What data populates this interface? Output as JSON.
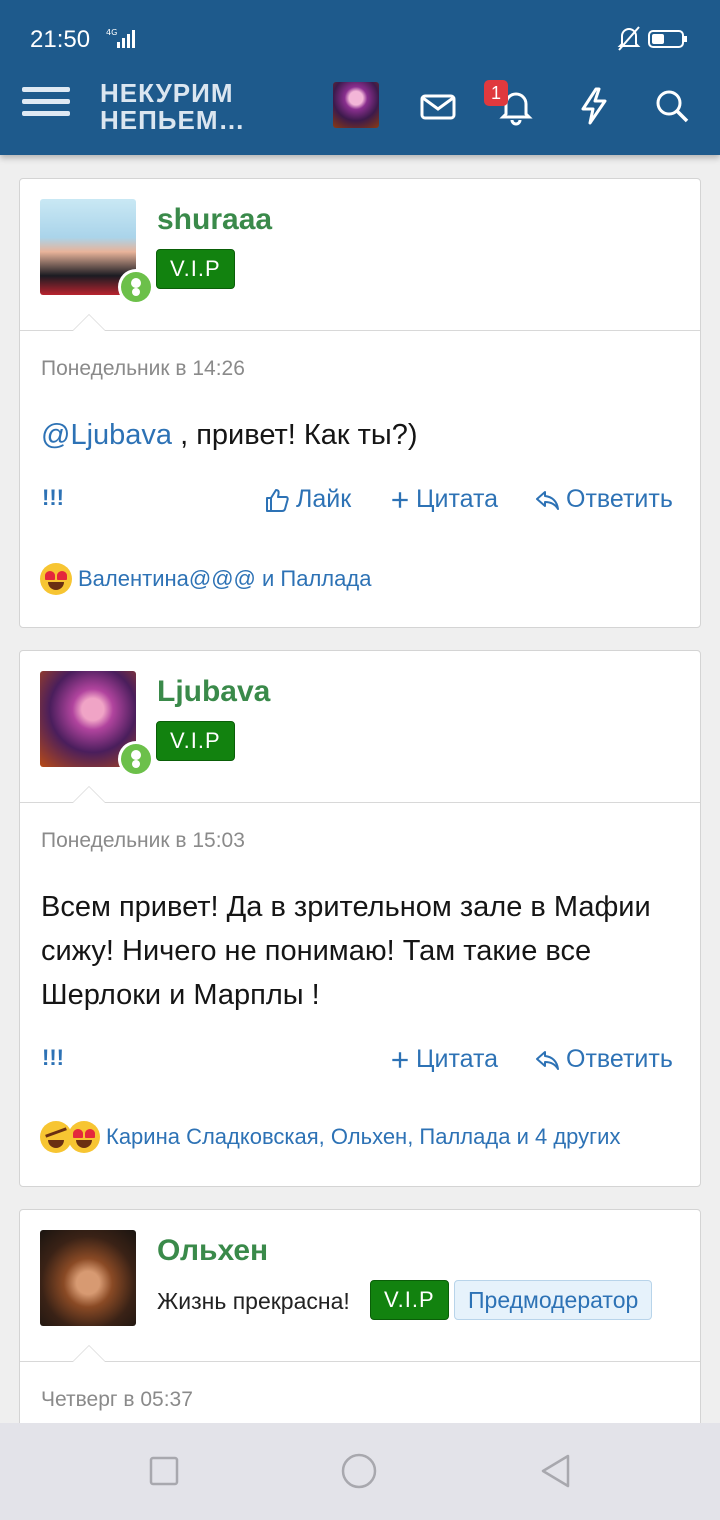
{
  "status_bar": {
    "time": "21:50",
    "network": "4G"
  },
  "header": {
    "logo_line1": "НЕКУРИМ",
    "logo_line2": "НЕПЬЕМ…",
    "notification_count": "1"
  },
  "posts": [
    {
      "username": "shuraaa",
      "badge": "V.I.P",
      "date": "Понедельник в 14:26",
      "mention": "@Ljubava",
      "message": " , привет! Как ты?)",
      "marker": "!!!",
      "like_label": "Лайк",
      "quote_label": "Цитата",
      "reply_label": "Ответить",
      "reactions": "Валентина@@@ и Паллада"
    },
    {
      "username": "Ljubava",
      "badge": "V.I.P",
      "date": "Понедельник в 15:03",
      "message": "Всем привет! Да в зрительном зале в Мафии сижу! Ничего не понимаю! Там такие все Шерлоки и Марплы !",
      "marker": "!!!",
      "quote_label": "Цитата",
      "reply_label": "Ответить",
      "reactions": "Карина Сладковская, Ольхен, Паллада и 4 других"
    },
    {
      "username": "Ольхен",
      "custom_title": "Жизнь прекрасна!",
      "badge": "V.I.P",
      "role_badge": "Предмодератор",
      "date": "Четверг в 05:37"
    }
  ],
  "colors": {
    "header_bg": "#1e5a8c",
    "username": "#3a8a4a",
    "link": "#2d72b5",
    "vip_bg": "#12820f",
    "badge_red": "#e0393e"
  }
}
